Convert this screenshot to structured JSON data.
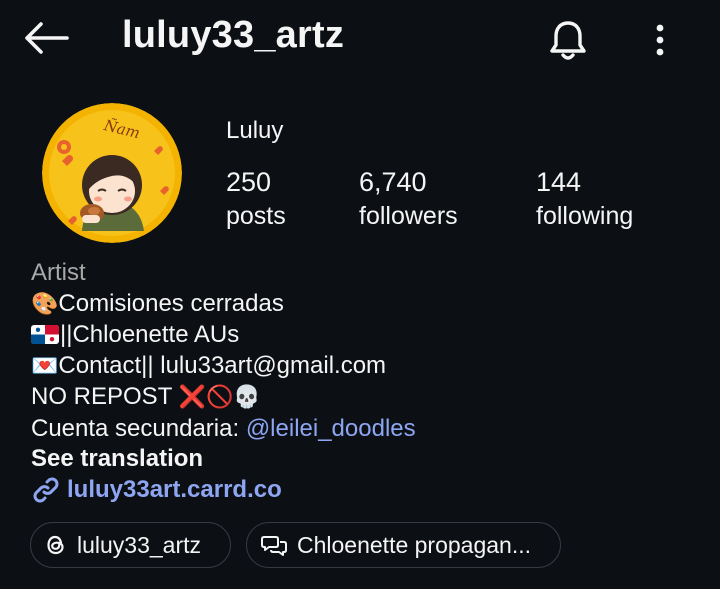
{
  "header": {
    "username": "luluy33_artz",
    "back_icon": "arrow-left-icon",
    "bell_icon": "bell-icon",
    "more_icon": "more-vertical-icon"
  },
  "profile": {
    "display_name": "Luluy",
    "avatar_text": "Ñam",
    "stats": [
      {
        "value": "250",
        "label": "posts"
      },
      {
        "value": "6,740",
        "label": "followers"
      },
      {
        "value": "144",
        "label": "following"
      }
    ]
  },
  "bio": {
    "category": "Artist",
    "line1_emoji": "🎨",
    "line1_text": "Comisiones cerradas",
    "line2_text": "||Chloenette AUs",
    "line3_emoji": "💌",
    "line3_text": "Contact|| lulu33art@gmail.com",
    "line4_text": "NO REPOST",
    "line4_emojis": "❌🚫💀",
    "line5_prefix": "Cuenta secundaria: ",
    "line5_mention": "@leilei_doodles",
    "see_translation": "See translation",
    "link": "luluy33art.carrd.co"
  },
  "chips": [
    {
      "label": "luluy33_artz",
      "icon": "threads-icon"
    },
    {
      "label": "Chloenette propagan...",
      "icon": "broadcast-channel-icon"
    }
  ],
  "colors": {
    "background": "#0c0f14",
    "text": "#f5f5f5",
    "secondary": "#a8a8a8",
    "link": "#8ea6f2",
    "chip_border": "#363a42",
    "avatar_bg": "#f4b300"
  }
}
